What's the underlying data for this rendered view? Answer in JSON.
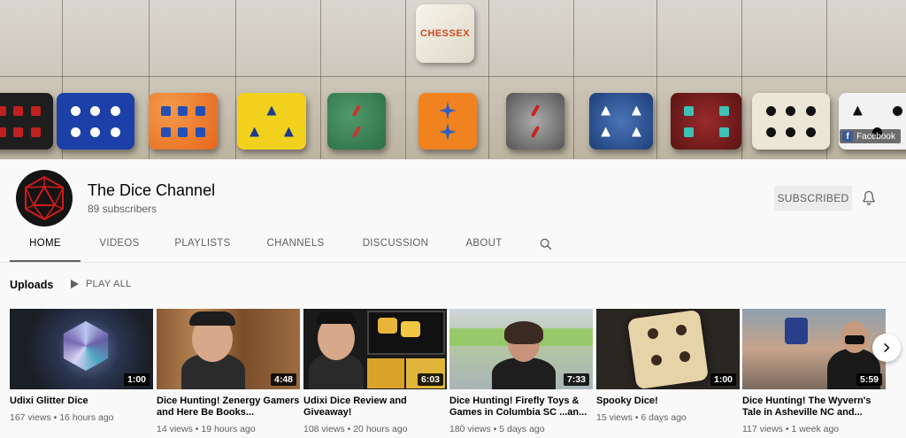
{
  "banner": {
    "logo_text": "CHESSEX",
    "facebook_label": "Facebook"
  },
  "channel": {
    "name": "The Dice Channel",
    "subscribers": "89 subscribers",
    "subscribe_label": "SUBSCRIBED"
  },
  "tabs": [
    {
      "label": "HOME",
      "active": true
    },
    {
      "label": "VIDEOS",
      "active": false
    },
    {
      "label": "PLAYLISTS",
      "active": false
    },
    {
      "label": "CHANNELS",
      "active": false
    },
    {
      "label": "DISCUSSION",
      "active": false
    },
    {
      "label": "ABOUT",
      "active": false
    }
  ],
  "uploads": {
    "title": "Uploads",
    "play_all": "PLAY ALL"
  },
  "videos": [
    {
      "title": "Udixi Glitter Dice",
      "duration": "1:00",
      "views": "167 views",
      "age": "16 hours ago"
    },
    {
      "title": "Dice Hunting! Zenergy Gamers and Here Be Books...",
      "duration": "4:48",
      "views": "14 views",
      "age": "19 hours ago"
    },
    {
      "title": "Udixi Dice Review and Giveaway!",
      "duration": "6:03",
      "views": "108 views",
      "age": "20 hours ago"
    },
    {
      "title": "Dice Hunting! Firefly Toys & Games in Columbia SC ...an...",
      "duration": "7:33",
      "views": "180 views",
      "age": "5 days ago"
    },
    {
      "title": "Spooky Dice!",
      "duration": "1:00",
      "views": "15 views",
      "age": "6 days ago"
    },
    {
      "title": "Dice Hunting! The Wyvern's Tale in Asheville NC and...",
      "duration": "5:59",
      "views": "117 views",
      "age": "1 week ago"
    }
  ],
  "colors": {
    "background": "#f9f9f9",
    "text_primary": "#030303",
    "text_secondary": "#606060",
    "subscribed_bg": "#ececec"
  },
  "icons": {
    "bell": "bell-icon",
    "search": "search-icon",
    "play": "play-icon",
    "next": "chevron-right-icon"
  }
}
